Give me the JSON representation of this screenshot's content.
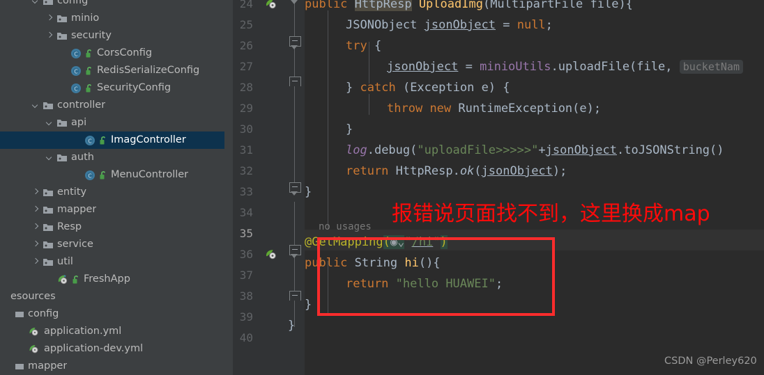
{
  "app": {
    "theme_bg_editor": "#2b2b2b",
    "theme_bg_sidebar": "#3c3f41",
    "selection_color": "#0d324d",
    "annotation_color": "#ff0a0a"
  },
  "sidebar": {
    "items": [
      {
        "label": "config",
        "indent": 2,
        "toggle": "down",
        "icon": "folder-icon",
        "badge": "",
        "selected": false,
        "clipped_top": true
      },
      {
        "label": "minio",
        "indent": 3,
        "toggle": "right",
        "icon": "folder-icon",
        "badge": "",
        "selected": false
      },
      {
        "label": "security",
        "indent": 3,
        "toggle": "right",
        "icon": "folder-icon",
        "badge": "",
        "selected": false
      },
      {
        "label": "CorsConfig",
        "indent": 4,
        "toggle": "none",
        "icon": "class-icon",
        "badge": "unlock-icon",
        "selected": false
      },
      {
        "label": "RedisSerializeConfig",
        "indent": 4,
        "toggle": "none",
        "icon": "class-icon",
        "badge": "unlock-icon",
        "selected": false
      },
      {
        "label": "SecurityConfig",
        "indent": 4,
        "toggle": "none",
        "icon": "class-icon",
        "badge": "unlock-icon",
        "selected": false
      },
      {
        "label": "controller",
        "indent": 2,
        "toggle": "down",
        "icon": "folder-icon",
        "badge": "",
        "selected": false
      },
      {
        "label": "api",
        "indent": 3,
        "toggle": "down",
        "icon": "folder-icon",
        "badge": "",
        "selected": false
      },
      {
        "label": "ImagController",
        "indent": 5,
        "toggle": "none",
        "icon": "class-icon",
        "badge": "unlock-icon",
        "selected": true
      },
      {
        "label": "auth",
        "indent": 3,
        "toggle": "down",
        "icon": "folder-icon",
        "badge": "",
        "selected": false
      },
      {
        "label": "MenuController",
        "indent": 5,
        "toggle": "none",
        "icon": "class-icon",
        "badge": "unlock-icon",
        "selected": false
      },
      {
        "label": "entity",
        "indent": 2,
        "toggle": "right",
        "icon": "folder-icon",
        "badge": "",
        "selected": false
      },
      {
        "label": "mapper",
        "indent": 2,
        "toggle": "right",
        "icon": "folder-icon",
        "badge": "",
        "selected": false
      },
      {
        "label": "Resp",
        "indent": 2,
        "toggle": "right",
        "icon": "folder-icon",
        "badge": "",
        "selected": false
      },
      {
        "label": "service",
        "indent": 2,
        "toggle": "right",
        "icon": "folder-icon",
        "badge": "",
        "selected": false
      },
      {
        "label": "util",
        "indent": 2,
        "toggle": "right",
        "icon": "folder-icon",
        "badge": "",
        "selected": false
      },
      {
        "label": "FreshApp",
        "indent": 3,
        "toggle": "none",
        "icon": "spring-app-icon",
        "badge": "unlock-icon",
        "selected": false
      },
      {
        "label": "esources",
        "indent": 0,
        "toggle": "none",
        "icon": "",
        "badge": "",
        "selected": false,
        "clipped_left": true
      },
      {
        "label": "config",
        "indent": 0,
        "toggle": "none",
        "icon": "res-folder-icon",
        "badge": "",
        "selected": false
      },
      {
        "label": "application.yml",
        "indent": 1,
        "toggle": "none",
        "icon": "spring-yml-icon",
        "badge": "",
        "selected": false
      },
      {
        "label": "application-dev.yml",
        "indent": 1,
        "toggle": "none",
        "icon": "spring-yml-icon",
        "badge": "",
        "selected": false
      },
      {
        "label": "mapper",
        "indent": 0,
        "toggle": "none",
        "icon": "res-folder-icon",
        "badge": "",
        "selected": false
      }
    ]
  },
  "editor": {
    "first_visible_line": 24,
    "current_line": 35,
    "line_numbers": [
      24,
      25,
      26,
      27,
      28,
      29,
      30,
      31,
      32,
      33,
      34,
      35,
      36,
      37,
      38,
      39,
      40
    ],
    "gutter_run_icons": [
      {
        "line": 24,
        "icon": "spring-bean-run-icon"
      },
      {
        "line": 36,
        "icon": "spring-bean-run-icon"
      }
    ],
    "inlay_hints": [
      {
        "line": 27,
        "text": "bucketNam",
        "kind": "parameter-hint",
        "clipped": true
      },
      {
        "above_line": 35,
        "text": "no usages",
        "kind": "usage-hint"
      }
    ],
    "code_lines": [
      {
        "n": 24,
        "text": "public HttpResp UploadImg(MultipartFile file){"
      },
      {
        "n": 25,
        "text": "    JSONObject jsonObject = null;"
      },
      {
        "n": 26,
        "text": "    try {"
      },
      {
        "n": 27,
        "text": "        jsonObject = minioUtils.uploadFile(file,  bucketNam"
      },
      {
        "n": 28,
        "text": "    } catch (Exception e) {"
      },
      {
        "n": 29,
        "text": "        throw new RuntimeException(e);"
      },
      {
        "n": 30,
        "text": "    }"
      },
      {
        "n": 31,
        "text": "    log.debug(\"uploadFile>>>>>\"+jsonObject.toJSONString()"
      },
      {
        "n": 32,
        "text": "    return HttpResp.ok(jsonObject);"
      },
      {
        "n": 33,
        "text": "}"
      },
      {
        "n": 34,
        "text": ""
      },
      {
        "n": 35,
        "text": "@GetMapping(\"/hi\")"
      },
      {
        "n": 36,
        "text": "public String hi(){"
      },
      {
        "n": 37,
        "text": "    return \"hello HUAWEI\";"
      },
      {
        "n": 38,
        "text": "}"
      },
      {
        "n": 39,
        "text": "}"
      },
      {
        "n": 40,
        "text": ""
      }
    ]
  },
  "annotation": {
    "note": "报错说页面找不到，这里换成map",
    "highlight_box_target": "@GetMapping(\"/hi\") public String hi(){ return \"hello HUAWEI\";"
  },
  "watermark": {
    "text": "CSDN @Perley620"
  }
}
